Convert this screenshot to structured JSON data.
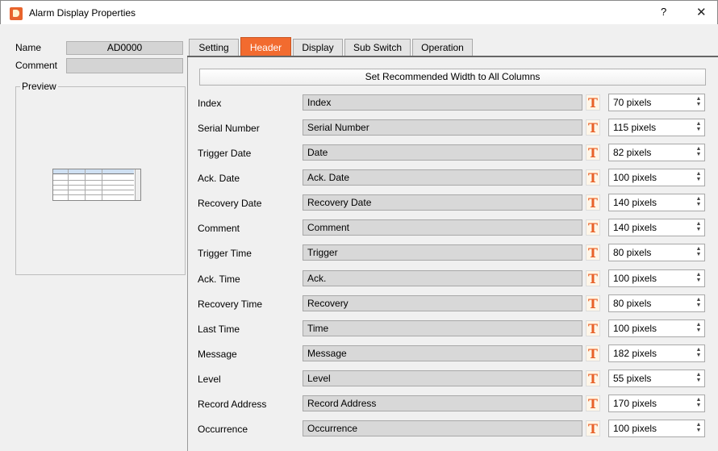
{
  "window": {
    "title": "Alarm Display Properties",
    "help": "?",
    "close": "✕"
  },
  "left": {
    "name_label": "Name",
    "name_value": "AD0000",
    "comment_label": "Comment",
    "comment_value": "",
    "preview_label": "Preview"
  },
  "tabs": [
    {
      "label": "Setting",
      "active": false
    },
    {
      "label": "Header",
      "active": true
    },
    {
      "label": "Display",
      "active": false
    },
    {
      "label": "Sub Switch",
      "active": false
    },
    {
      "label": "Operation",
      "active": false
    }
  ],
  "set_width_button": "Set Recommended Width to All Columns",
  "columns": [
    {
      "label": "Index",
      "header": "Index",
      "width": "70 pixels"
    },
    {
      "label": "Serial Number",
      "header": "Serial Number",
      "width": "115 pixels"
    },
    {
      "label": "Trigger Date",
      "header": "Date",
      "width": "82 pixels"
    },
    {
      "label": "Ack. Date",
      "header": "Ack. Date",
      "width": "100 pixels"
    },
    {
      "label": "Recovery Date",
      "header": "Recovery Date",
      "width": "140 pixels"
    },
    {
      "label": "Comment",
      "header": "Comment",
      "width": "140 pixels"
    },
    {
      "label": "Trigger Time",
      "header": "Trigger",
      "width": "80 pixels"
    },
    {
      "label": "Ack. Time",
      "header": "Ack.",
      "width": "100 pixels"
    },
    {
      "label": "Recovery Time",
      "header": "Recovery",
      "width": "80 pixels"
    },
    {
      "label": "Last Time",
      "header": "Time",
      "width": "100 pixels"
    },
    {
      "label": "Message",
      "header": "Message",
      "width": "182 pixels"
    },
    {
      "label": "Level",
      "header": "Level",
      "width": "55 pixels"
    },
    {
      "label": "Record Address",
      "header": "Record Address",
      "width": "170 pixels"
    },
    {
      "label": "Occurrence",
      "header": "Occurrence",
      "width": "100 pixels"
    }
  ],
  "icons": {
    "text_style": "T",
    "spin_up": "▲",
    "spin_down": "▼"
  },
  "colors": {
    "accent": "#f26b2f",
    "text_icon": "#e8622a"
  }
}
